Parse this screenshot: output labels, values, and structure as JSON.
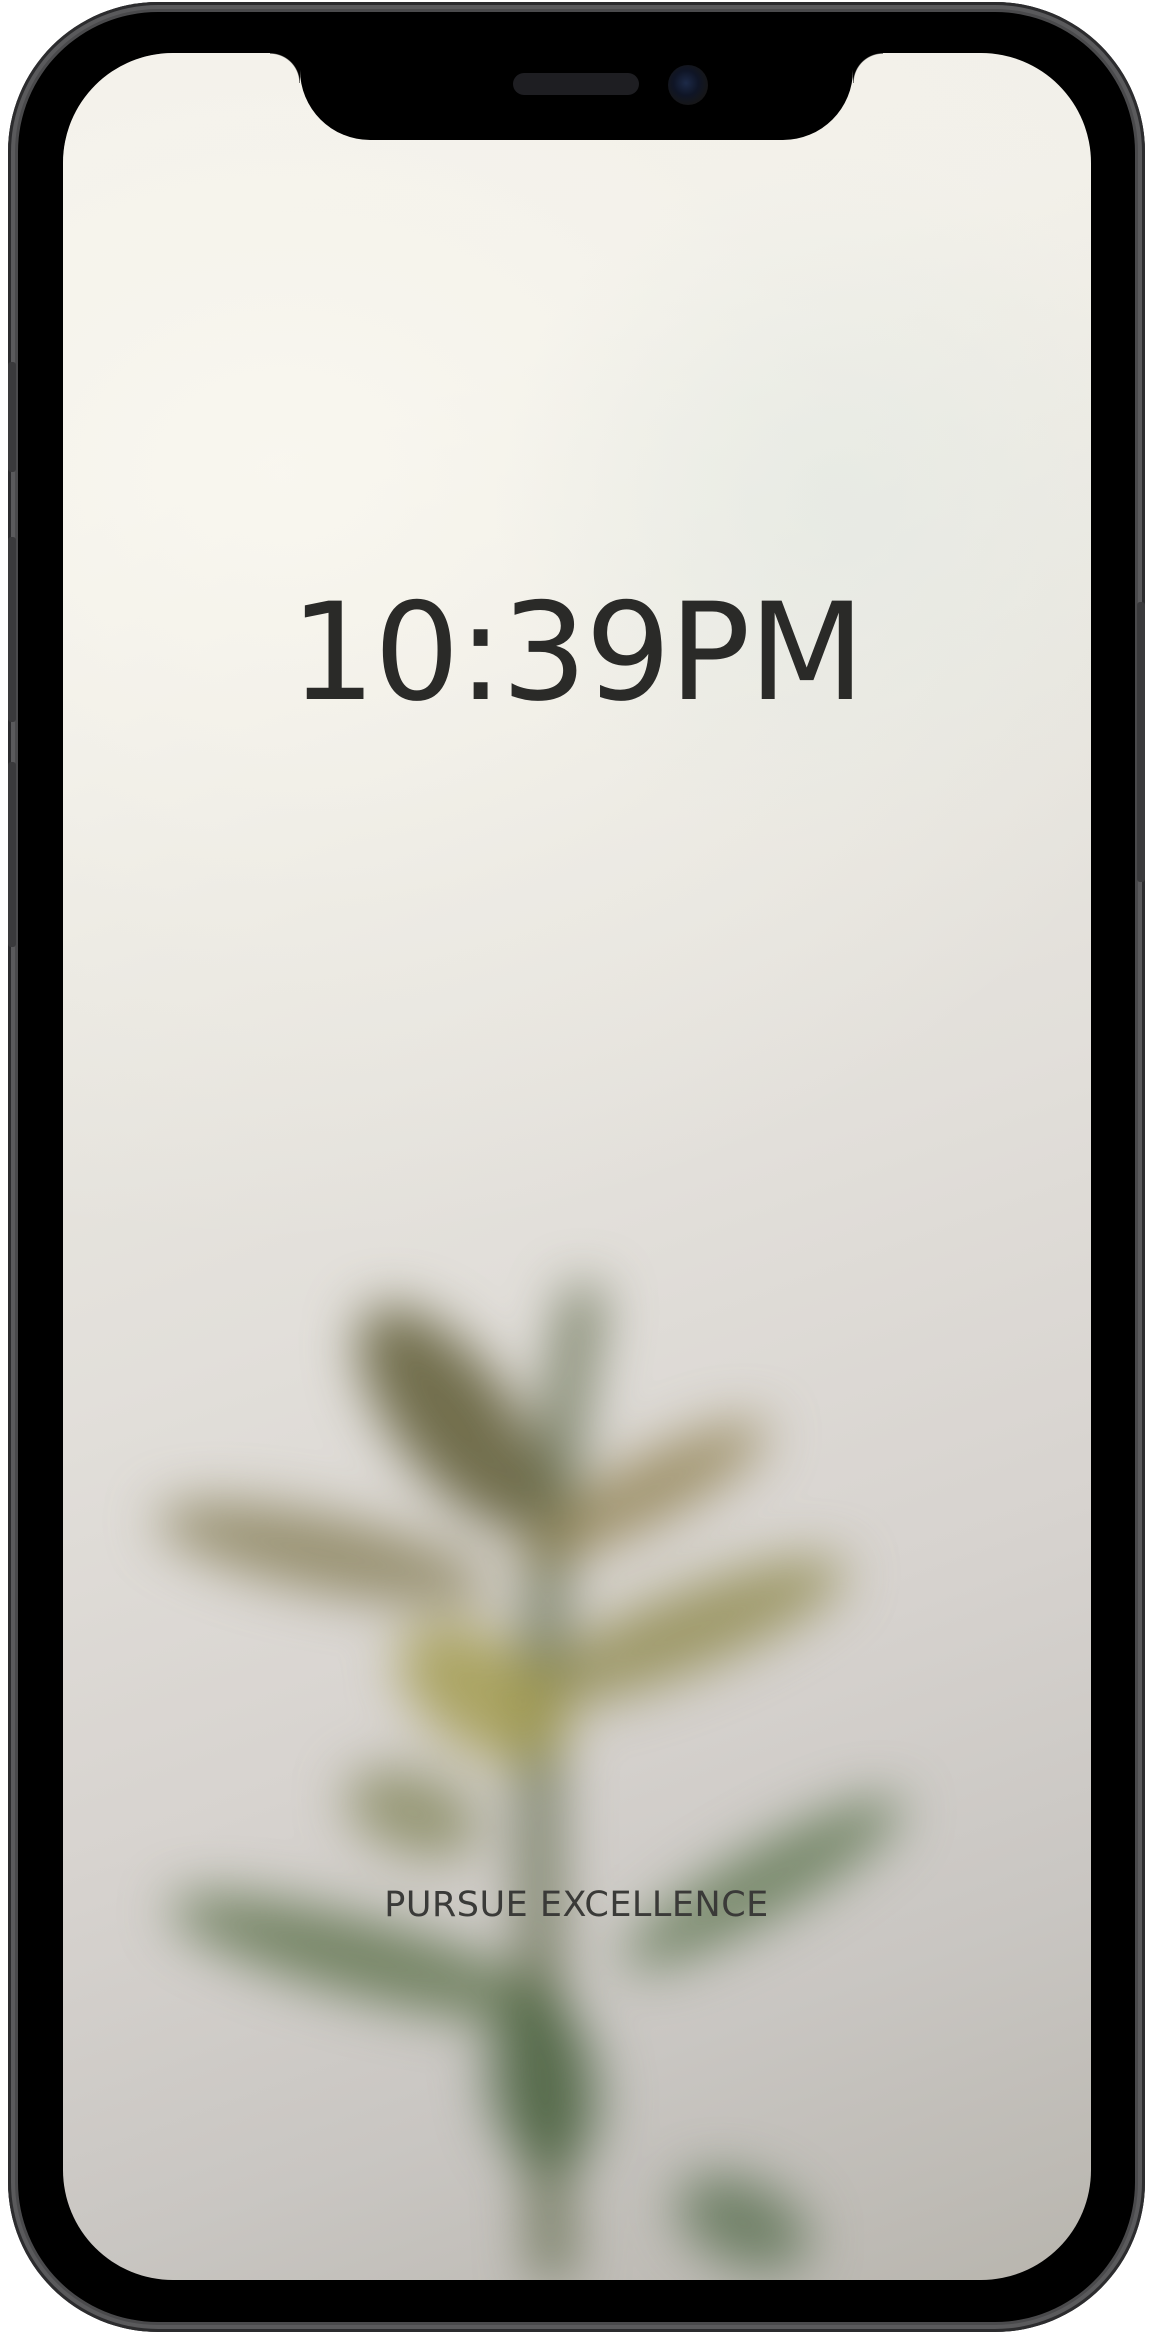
{
  "lock_screen": {
    "time": "10:39PM",
    "tagline": "PURSUE EXCELLENCE",
    "wallpaper": {
      "subject": "blurred-plant",
      "colors": {
        "top": "#f3f1ea",
        "bottom": "#b8b5ae",
        "leaf_dark": "#4a5530",
        "leaf_light": "#9a9046"
      }
    },
    "text_color": "#2a2a28"
  },
  "device": {
    "frame_color": "#4a4a4c",
    "bezel_color": "#000000"
  }
}
